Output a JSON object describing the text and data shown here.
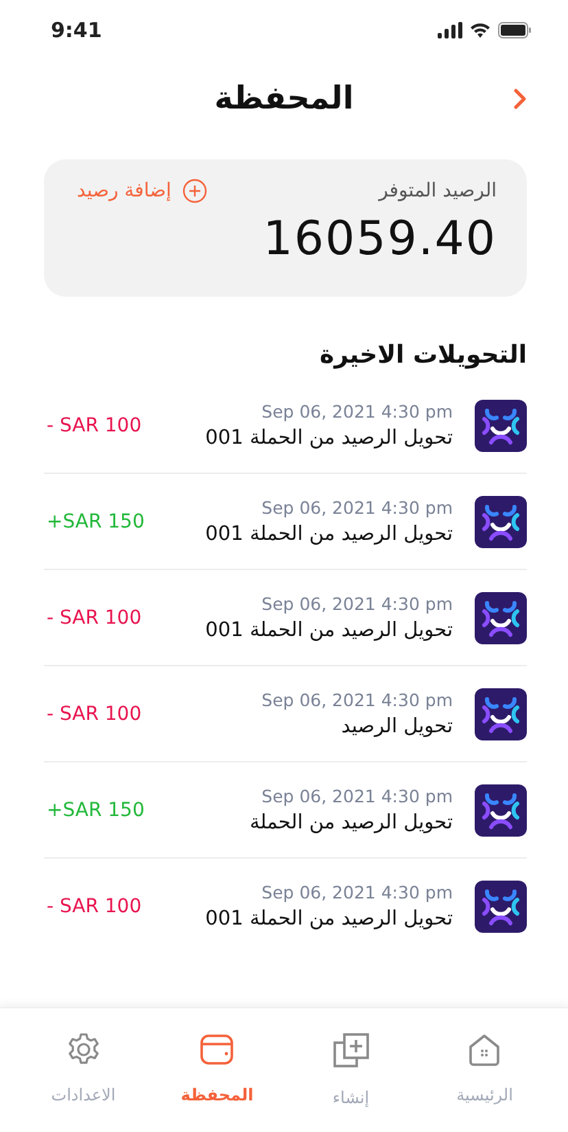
{
  "status_bar": {
    "time": "9:41"
  },
  "header": {
    "title": "المحفظة"
  },
  "balance": {
    "label": "الرصيد المتوفر",
    "amount": "16059.40",
    "add_button": "إضافة رصيد"
  },
  "transactions": {
    "title": "التحويلات الاخيرة",
    "items": [
      {
        "date": "Sep 06, 2021 4:30 pm",
        "description": "تحويل الرصيد من الحملة 001",
        "amount": "- SAR 100",
        "kind": "debit"
      },
      {
        "date": "Sep 06, 2021 4:30 pm",
        "description": "تحويل الرصيد من الحملة 001",
        "amount": "+SAR 150",
        "kind": "credit"
      },
      {
        "date": "Sep 06, 2021 4:30 pm",
        "description": "تحويل الرصيد من الحملة 001",
        "amount": "- SAR 100",
        "kind": "debit"
      },
      {
        "date": "Sep 06, 2021 4:30 pm",
        "description": "تحويل الرصيد",
        "amount": "- SAR 100",
        "kind": "debit"
      },
      {
        "date": "Sep 06, 2021 4:30 pm",
        "description": "تحويل الرصيد من الحملة",
        "amount": "+SAR 150",
        "kind": "credit"
      },
      {
        "date": "Sep 06, 2021 4:30 pm",
        "description": "تحويل الرصيد من الحملة 001",
        "amount": "- SAR 100",
        "kind": "debit"
      }
    ]
  },
  "tab_bar": [
    {
      "label": "الرئيسية",
      "kind": "home",
      "selected": false
    },
    {
      "label": "إنشاء",
      "kind": "create",
      "selected": false
    },
    {
      "label": "المحفظة",
      "kind": "wallet",
      "selected": true
    },
    {
      "label": "الاعدادات",
      "kind": "settings",
      "selected": false
    }
  ]
}
